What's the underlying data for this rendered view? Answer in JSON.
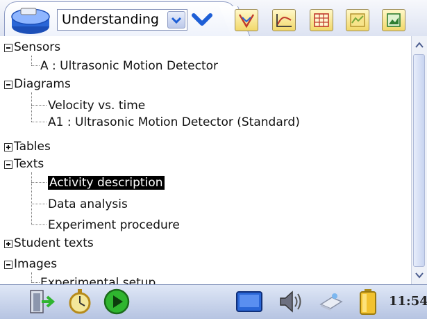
{
  "toolbar": {
    "mode_selected": "Understanding",
    "icons": [
      "app-device-icon",
      "mode-dropdown-arrow",
      "chevron-down-icon",
      "sensor-tool-icon",
      "graph-tool-icon",
      "table-tool-icon",
      "map-tool-icon",
      "image-tool-icon"
    ]
  },
  "tree": {
    "sensors": {
      "label": "Sensors",
      "children": [
        "A : Ultrasonic Motion Detector"
      ]
    },
    "diagrams": {
      "label": "Diagrams",
      "children": [
        "Velocity vs. time",
        "A1 : Ultrasonic Motion Detector (Standard)"
      ]
    },
    "tables": {
      "label": "Tables"
    },
    "texts": {
      "label": "Texts",
      "children": [
        "Activity description",
        "Data analysis",
        "Experiment procedure"
      ],
      "selected": "Activity description"
    },
    "student_texts": {
      "label": "Student texts"
    },
    "images": {
      "label": "Images",
      "children": [
        "Experimental setup"
      ]
    }
  },
  "taskbar": {
    "clock": "11:54",
    "icons": [
      "exit-icon",
      "timer-icon",
      "play-icon",
      "screen-icon",
      "speaker-icon",
      "network-icon",
      "battery-icon"
    ]
  },
  "colors": {
    "selection_bg": "#000000",
    "toolbar_accent": "#1e5fd6",
    "play_green": "#2fb52f"
  }
}
